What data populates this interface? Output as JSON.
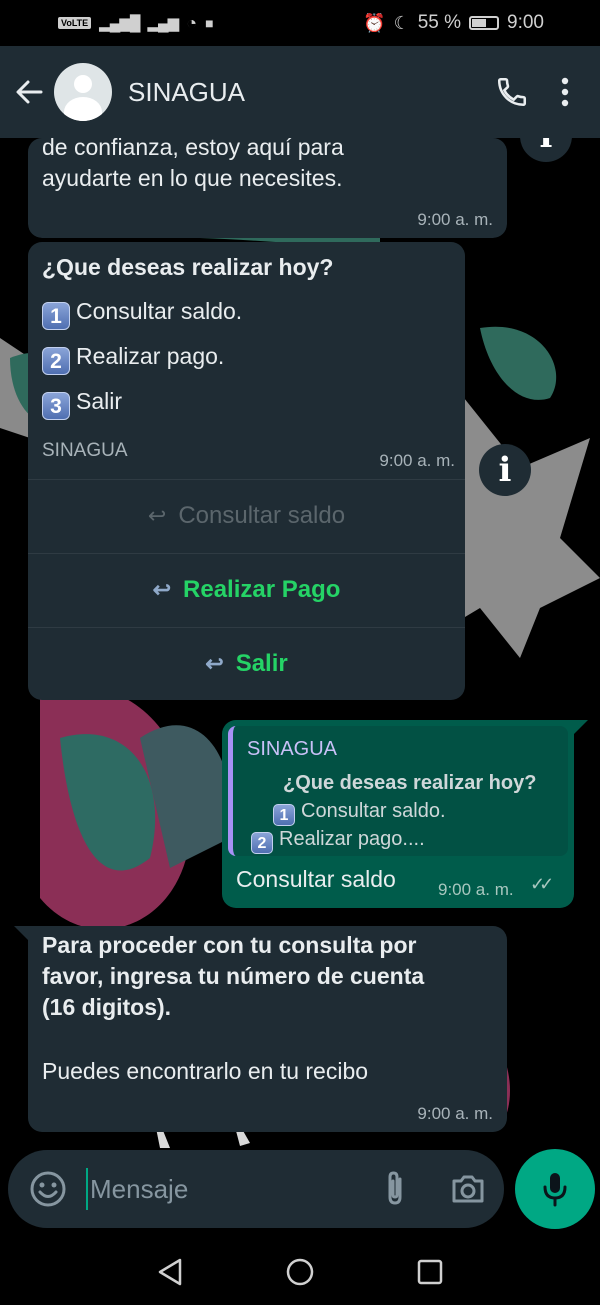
{
  "status_bar": {
    "battery_percent": "55 %",
    "time": "9:00"
  },
  "header": {
    "contact_name": "SINAGUA"
  },
  "messages": [
    {
      "direction": "in",
      "text_line1": "de confianza, estoy aquí para",
      "text_line2": "ayudarte en lo que necesites.",
      "time": "9:00 a. m."
    },
    {
      "direction": "in",
      "title": "¿Que deseas realizar hoy?",
      "options": [
        {
          "num": "1",
          "label": "Consultar saldo."
        },
        {
          "num": "2",
          "label": "Realizar pago."
        },
        {
          "num": "3",
          "label": "Salir"
        }
      ],
      "footer": "SINAGUA",
      "time": "9:00 a. m.",
      "quick_replies": [
        {
          "label": "Consultar saldo",
          "state": "disabled"
        },
        {
          "label": "Realizar Pago",
          "state": "active"
        },
        {
          "label": "Salir",
          "state": "active"
        }
      ]
    },
    {
      "direction": "out",
      "quote_author": "SINAGUA",
      "quote_title": "¿Que deseas realizar hoy?",
      "quote_line1_num": "1",
      "quote_line1": "Consultar saldo.",
      "quote_line2_num": "2",
      "quote_line2": "Realizar pago....",
      "text": "Consultar saldo",
      "time": "9:00 a. m.",
      "ticks": "✓✓"
    },
    {
      "direction": "in",
      "bold_line1": "Para proceder con tu consulta por",
      "bold_line2": "favor, ingresa tu número de cuenta",
      "bold_line3": "(16 digitos).",
      "text": "Puedes encontrarlo en tu recibo",
      "time": "9:00 a. m."
    }
  ],
  "composer": {
    "placeholder": "Mensaje"
  },
  "colors": {
    "header_bg": "#1f2c34",
    "incoming_bubble": "#1f2c34",
    "outgoing_bubble": "#005c4b",
    "accent_green": "#00a884",
    "quick_reply_text": "#25d366"
  },
  "icons": [
    "back-arrow-icon",
    "avatar-icon",
    "phone-icon",
    "more-vertical-icon",
    "info-icon",
    "reply-icon",
    "emoji-icon",
    "attach-icon",
    "camera-icon",
    "mic-icon",
    "nav-back-icon",
    "nav-home-icon",
    "nav-recents-icon"
  ]
}
